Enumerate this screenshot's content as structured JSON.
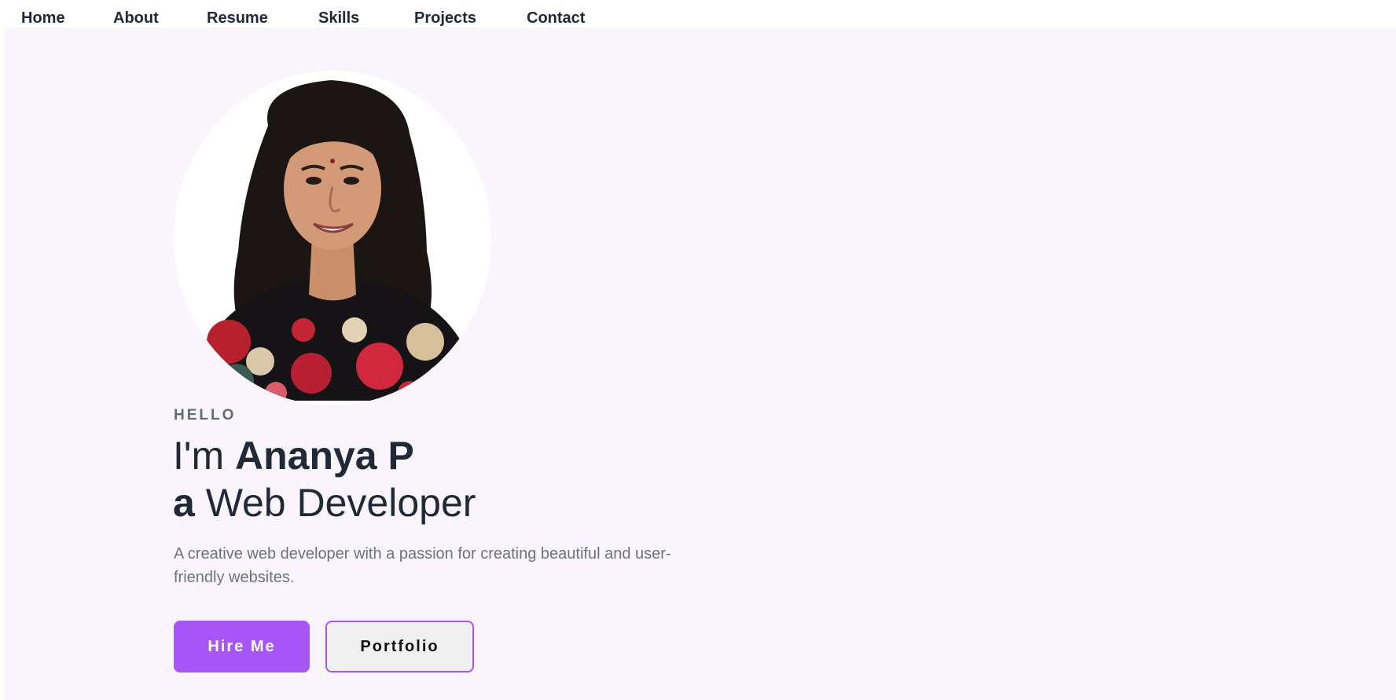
{
  "nav": {
    "items": [
      {
        "label": "Home"
      },
      {
        "label": "About"
      },
      {
        "label": "Resume"
      },
      {
        "label": "Skills"
      },
      {
        "label": "Projects"
      },
      {
        "label": "Contact"
      }
    ]
  },
  "hero": {
    "eyebrow": "HELLO",
    "line1_prefix": "I'm ",
    "name": "Ananya P",
    "line2_prefix": "a",
    "role": " Web Developer",
    "description": "A creative web developer with a passion for creating beautiful and user-friendly websites.",
    "primary_button": "Hire Me",
    "secondary_button": "Portfolio"
  },
  "colors": {
    "accent": "#a855f7",
    "hero_background": "#faf4fd",
    "heading_text": "#1f2937",
    "muted_text": "#6b7280"
  }
}
